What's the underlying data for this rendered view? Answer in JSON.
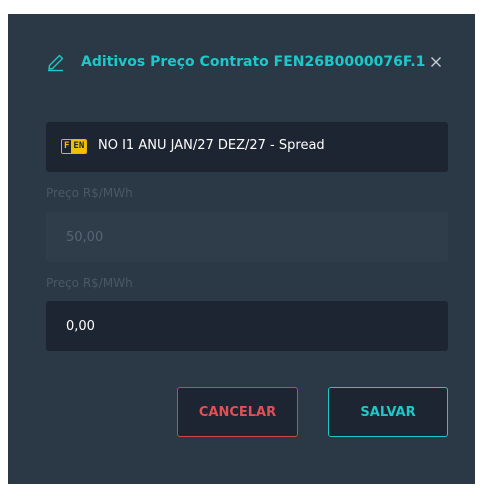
{
  "modal": {
    "title": "Aditivos Preço Contrato FEN26B0000076F.1",
    "icons": {
      "title_icon": "pencil-edit-icon",
      "close_icon": "close-x-icon"
    },
    "product": {
      "badge_left": "F",
      "badge_right": "EN",
      "name": "NO I1 ANU JAN/27 DEZ/27 - Spread"
    },
    "fields": [
      {
        "label": "Preço R$/MWh",
        "value": "50,00",
        "disabled": true
      },
      {
        "label": "Preço R$/MWh",
        "value": "0,00",
        "disabled": false
      }
    ],
    "buttons": {
      "cancel_label": "CANCELAR",
      "save_label": "SALVAR"
    }
  },
  "colors": {
    "modal_bg": "#2b3845",
    "field_bg": "#1c2531",
    "accent_teal": "#1ec8c8",
    "cancel_red": "#d0454a",
    "badge_yellow": "#f0c000",
    "label_gray": "#4a5866"
  }
}
